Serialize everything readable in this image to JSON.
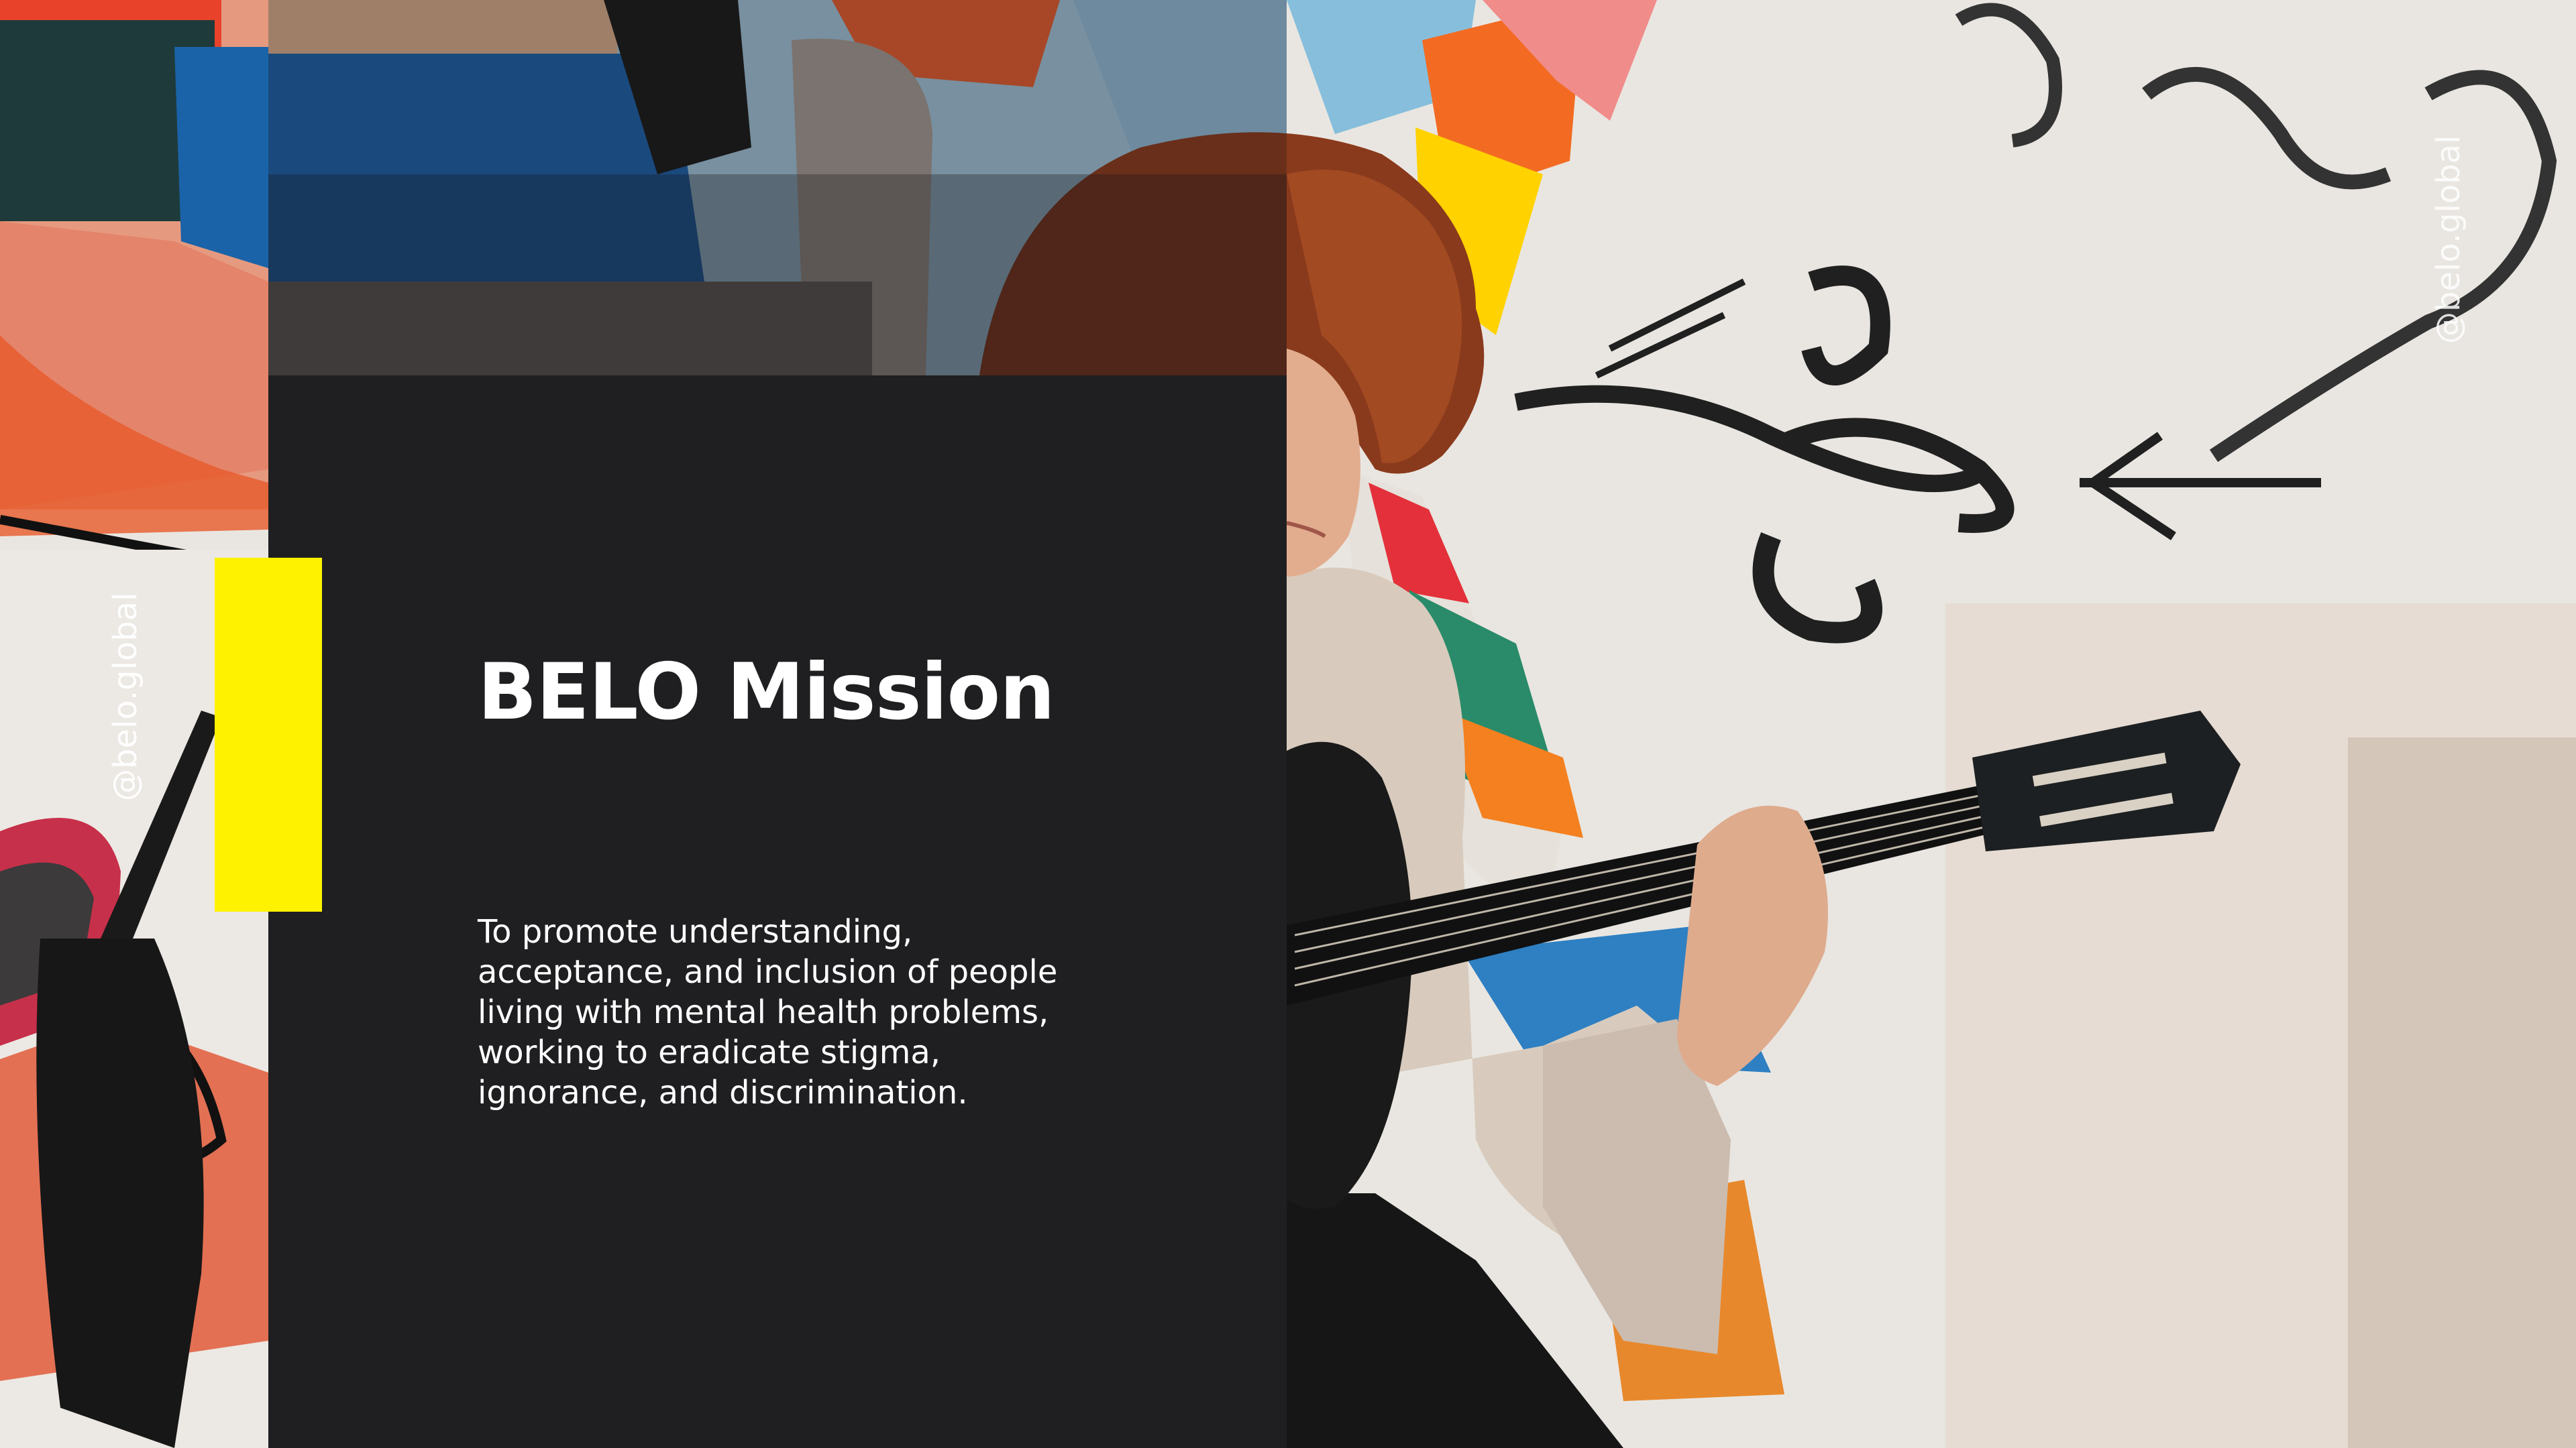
{
  "slide": {
    "title": "BELO Mission",
    "mission_lines": [
      "To promote understanding,",
      "acceptance, and inclusion of people",
      "living with mental health problems,",
      "working to eradicate stigma,",
      "ignorance, and discrimination."
    ],
    "social_handle": "@belo.global"
  },
  "colors": {
    "panel": "#1f1f21",
    "accent": "#fff200",
    "text": "#ffffff"
  },
  "photo": {
    "subject_icon": "guitarist-photo",
    "background_icon": "painted-mural"
  }
}
